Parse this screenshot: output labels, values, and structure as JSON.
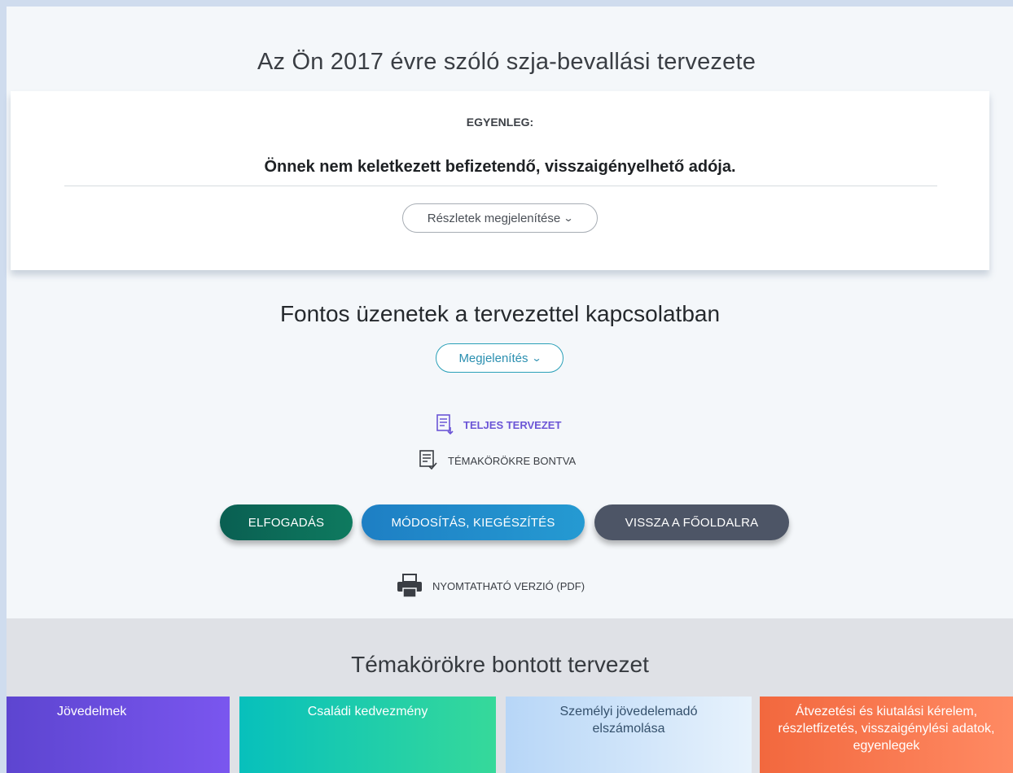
{
  "header": {
    "title": "Az Ön 2017 évre szóló szja-bevallási tervezete"
  },
  "balance_card": {
    "label": "EGYENLEG:",
    "message": "Önnek nem keletkezett befizetendő, visszaigényelhető adója.",
    "details_button": "Részletek megjelenítése"
  },
  "messages_section": {
    "title": "Fontos üzenetek a tervezettel kapcsolatban",
    "show_button": "Megjelenítés"
  },
  "links": {
    "full_draft": "TELJES TERVEZET",
    "by_topic": "TÉMAKÖRÖKRE BONTVA",
    "printable": "NYOMTATHATÓ VERZIÓ (PDF)"
  },
  "actions": {
    "accept": "ELFOGADÁS",
    "modify": "MÓDOSÍTÁS, KIEGÉSZÍTÉS",
    "back": "VISSZA A FŐOLDALRA"
  },
  "topics": {
    "title": "Témakörökre bontott tervezet",
    "tiles": [
      {
        "label": "Jövedelmek"
      },
      {
        "label": "Családi kedvezmény"
      },
      {
        "label": "Személyi jövedelemadó elszámolása"
      },
      {
        "label": "Átvezetési és kiutalási kérelem, részletfizetés, visszaigénylési adatok, egyenlegek"
      }
    ]
  },
  "colors": {
    "accent_purple": "#6b55d6",
    "accept_green": "#0e7a5f",
    "modify_blue": "#259ad2",
    "back_slate": "#4d5566"
  },
  "icons": {
    "full_draft": "document-download-icon",
    "by_topic": "document-check-icon",
    "printable": "printer-icon",
    "chevron": "chevron-down-icon"
  }
}
